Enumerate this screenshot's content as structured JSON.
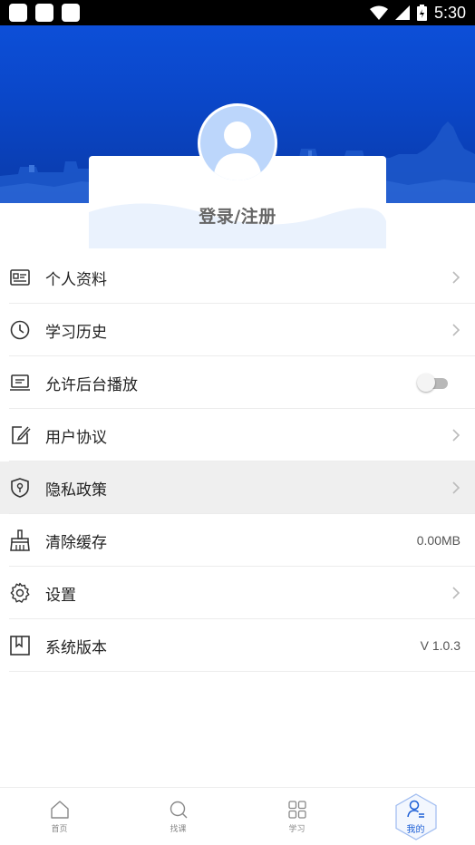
{
  "status_bar": {
    "time": "5:30"
  },
  "profile": {
    "login_label": "登录/注册"
  },
  "menu": [
    {
      "label": "个人资料",
      "icon": "id-card-icon",
      "right": "chevron"
    },
    {
      "label": "学习历史",
      "icon": "clock-icon",
      "right": "chevron"
    },
    {
      "label": "允许后台播放",
      "icon": "laptop-icon",
      "right": "toggle",
      "toggle_on": false
    },
    {
      "label": "用户协议",
      "icon": "edit-icon",
      "right": "chevron"
    },
    {
      "label": "隐私政策",
      "icon": "shield-icon",
      "right": "chevron"
    },
    {
      "label": "清除缓存",
      "icon": "broom-icon",
      "right": "text",
      "value": "0.00MB"
    },
    {
      "label": "设置",
      "icon": "gear-icon",
      "right": "chevron"
    },
    {
      "label": "系统版本",
      "icon": "bookmark-icon",
      "right": "text",
      "value": "V 1.0.3"
    }
  ],
  "tabbar": [
    {
      "label": "首页",
      "icon": "home-icon",
      "active": false
    },
    {
      "label": "找课",
      "icon": "search-icon",
      "active": false
    },
    {
      "label": "学习",
      "icon": "grid-icon",
      "active": false
    },
    {
      "label": "我的",
      "icon": "user-icon",
      "active": true
    }
  ],
  "colors": {
    "accent": "#1d5fd6",
    "banner": "#0d4fd8",
    "avatar_bg": "#bcd6fb"
  }
}
